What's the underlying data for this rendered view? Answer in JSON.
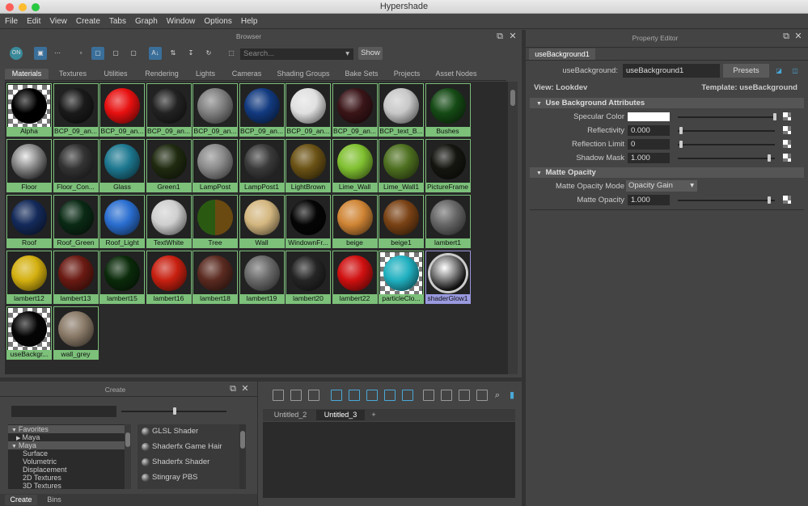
{
  "app": {
    "title": "Hypershade"
  },
  "menu": [
    "File",
    "Edit",
    "View",
    "Create",
    "Tabs",
    "Graph",
    "Window",
    "Options",
    "Help"
  ],
  "browser": {
    "title": "Browser",
    "search_placeholder": "Search...",
    "show_label": "Show",
    "tabs": [
      "Materials",
      "Textures",
      "Utilities",
      "Rendering",
      "Lights",
      "Cameras",
      "Shading Groups",
      "Bake Sets",
      "Projects",
      "Asset Nodes"
    ],
    "active_tab": "Materials",
    "materials": [
      {
        "name": "Alpha",
        "color": "#000000",
        "bg": "checker"
      },
      {
        "name": "BCP_09_an...",
        "color": "#1a1a1a",
        "bg": "dark"
      },
      {
        "name": "BCP_09_an...",
        "color": "#e81010",
        "bg": "dark"
      },
      {
        "name": "BCP_09_an...",
        "color": "#222222",
        "bg": "dark"
      },
      {
        "name": "BCP_09_an...",
        "color": "#808080",
        "bg": "dark"
      },
      {
        "name": "BCP_09_an...",
        "color": "#123a80",
        "bg": "dark"
      },
      {
        "name": "BCP_09_an...",
        "color": "#e0e0e0",
        "bg": "dark"
      },
      {
        "name": "BCP_09_an...",
        "color": "#3a1518",
        "bg": "dark"
      },
      {
        "name": "BCP_text_B...",
        "color": "#c8c8c8",
        "bg": "dark"
      },
      {
        "name": "Bushes",
        "color": "#154a15",
        "bg": "dark"
      },
      {
        "name": "Floor",
        "color": "#aaaaaa",
        "bg": "logo"
      },
      {
        "name": "Floor_Con...",
        "color": "#333333",
        "bg": "dark"
      },
      {
        "name": "Glass",
        "color": "#1d7890",
        "bg": "dark"
      },
      {
        "name": "Green1",
        "color": "#1f2a10",
        "bg": "dark"
      },
      {
        "name": "LampPost",
        "color": "#8a8a8a",
        "bg": "dark"
      },
      {
        "name": "LampPost1",
        "color": "#3a3a3a",
        "bg": "dark"
      },
      {
        "name": "LightBrown",
        "color": "#6b5215",
        "bg": "dark"
      },
      {
        "name": "Lime_Wall",
        "color": "#80c030",
        "bg": "dark"
      },
      {
        "name": "Lime_Wall1",
        "color": "#4e7020",
        "bg": "dark"
      },
      {
        "name": "PictureFrame",
        "color": "#151510",
        "bg": "dark"
      },
      {
        "name": "Roof",
        "color": "#142a5a",
        "bg": "dark"
      },
      {
        "name": "Roof_Green",
        "color": "#0a2a15",
        "bg": "dark"
      },
      {
        "name": "Roof_Light",
        "color": "#2a6ed0",
        "bg": "dark"
      },
      {
        "name": "TextWhite",
        "color": "#cfcfcf",
        "bg": "dark"
      },
      {
        "name": "Tree",
        "color": "#2a5a12",
        "bg": "tree"
      },
      {
        "name": "Wall",
        "color": "#d4b780",
        "bg": "dark"
      },
      {
        "name": "WindownFr...",
        "color": "#050505",
        "bg": "dark"
      },
      {
        "name": "beige",
        "color": "#d08535",
        "bg": "dark"
      },
      {
        "name": "beige1",
        "color": "#7a4215",
        "bg": "dark"
      },
      {
        "name": "lambert1",
        "color": "#666666",
        "bg": "dark"
      },
      {
        "name": "lambert12",
        "color": "#d4b010",
        "bg": "dark"
      },
      {
        "name": "lambert13",
        "color": "#6a1a12",
        "bg": "dark"
      },
      {
        "name": "lambert15",
        "color": "#0a2a0a",
        "bg": "dark"
      },
      {
        "name": "lambert16",
        "color": "#c82010",
        "bg": "dark"
      },
      {
        "name": "lambert18",
        "color": "#5a2a20",
        "bg": "dark"
      },
      {
        "name": "lambert19",
        "color": "#6a6a6a",
        "bg": "dark"
      },
      {
        "name": "lambert20",
        "color": "#252525",
        "bg": "dark"
      },
      {
        "name": "lambert22",
        "color": "#d01010",
        "bg": "dark"
      },
      {
        "name": "particleClo...",
        "color": "#20b0c0",
        "bg": "checker"
      },
      {
        "name": "shaderGlow1",
        "color": "#dddddd",
        "bg": "glow"
      },
      {
        "name": "useBackgr...",
        "color": "#050505",
        "bg": "checker"
      },
      {
        "name": "wall_grey",
        "color": "#8a7a68",
        "bg": "dark"
      }
    ]
  },
  "create_panel": {
    "title": "Create",
    "tree": [
      "Favorites",
      "Maya",
      "Maya",
      "Surface",
      "Volumetric",
      "Displacement",
      "2D Textures",
      "3D Textures"
    ],
    "nodes": [
      "GLSL Shader",
      "Shaderfx Game Hair",
      "Shaderfx Shader",
      "Stingray PBS"
    ],
    "bottom_tabs": [
      "Create",
      "Bins"
    ]
  },
  "graph": {
    "tabs": [
      "Untitled_2",
      "Untitled_3",
      "+"
    ],
    "active_tab": "Untitled_3"
  },
  "property_editor": {
    "title": "Property Editor",
    "node_tab": "useBackground1",
    "node_label": "useBackground:",
    "node_value": "useBackground1",
    "presets_label": "Presets",
    "view_label": "View: Lookdev",
    "template_label": "Template: useBackground",
    "section1": "Use Background Attributes",
    "attrs1": [
      {
        "label": "Specular Color",
        "value": "",
        "swatch": "#ffffff",
        "level": 1.0
      },
      {
        "label": "Reflectivity",
        "value": "0.000",
        "level": 0.0
      },
      {
        "label": "Reflection Limit",
        "value": "0",
        "level": 0.0
      },
      {
        "label": "Shadow Mask",
        "value": "1.000",
        "level": 1.0
      }
    ],
    "section2": "Matte Opacity",
    "matte_mode_label": "Matte Opacity Mode",
    "matte_mode_value": "Opacity Gain",
    "matte_opacity_label": "Matte Opacity",
    "matte_opacity_value": "1.000",
    "matte_opacity_level": 1.0
  }
}
